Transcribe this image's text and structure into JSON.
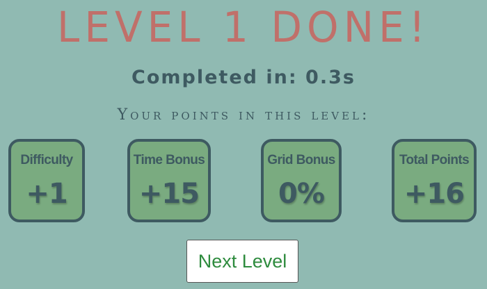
{
  "title": "LEVEL 1 DONE!",
  "completed_text": "Completed in: 0.3s",
  "points_heading": "Your points in this level:",
  "cards": [
    {
      "label": "Difficulty",
      "value": "+1"
    },
    {
      "label": "Time Bonus",
      "value": "+15"
    },
    {
      "label": "Grid Bonus",
      "value": "0%"
    },
    {
      "label": "Total Points",
      "value": "+16"
    }
  ],
  "next_button_label": "Next Level",
  "colors": {
    "background": "#90bab2",
    "title": "#c0706a",
    "text_dark": "#3e5a61",
    "card_fill": "#7aab80",
    "button_text": "#2e8b3e"
  }
}
